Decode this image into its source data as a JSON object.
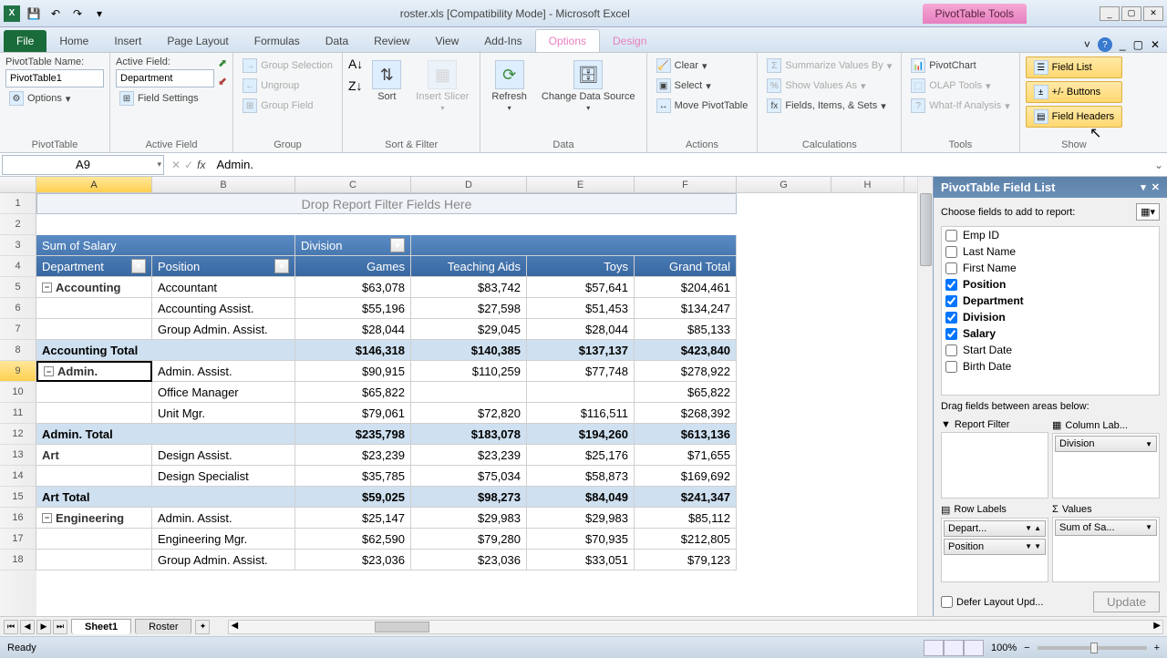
{
  "title": "roster.xls  [Compatibility Mode] - Microsoft Excel",
  "context_tab": "PivotTable Tools",
  "tabs": [
    "File",
    "Home",
    "Insert",
    "Page Layout",
    "Formulas",
    "Data",
    "Review",
    "View",
    "Add-Ins",
    "Options",
    "Design"
  ],
  "active_tab": "Options",
  "ribbon": {
    "pt_name_label": "PivotTable Name:",
    "pt_name": "PivotTable1",
    "options": "Options",
    "group_pt": "PivotTable",
    "af_label": "Active Field:",
    "af_name": "Department",
    "field_settings": "Field Settings",
    "group_af": "Active Field",
    "grp_sel": "Group Selection",
    "ungroup": "Ungroup",
    "grp_field": "Group Field",
    "group_grp": "Group",
    "sort": "Sort",
    "insert_slicer": "Insert Slicer",
    "group_sort": "Sort & Filter",
    "refresh": "Refresh",
    "change_ds": "Change Data Source",
    "group_data": "Data",
    "clear": "Clear",
    "select": "Select",
    "move_pt": "Move PivotTable",
    "group_actions": "Actions",
    "sum_values": "Summarize Values By",
    "show_values": "Show Values As",
    "fields_items": "Fields, Items, & Sets",
    "group_calc": "Calculations",
    "pivotchart": "PivotChart",
    "olap": "OLAP Tools",
    "whatif": "What-If Analysis",
    "group_tools": "Tools",
    "field_list": "Field List",
    "pm_buttons": "+/- Buttons",
    "field_headers": "Field Headers",
    "group_show": "Show"
  },
  "namebox": "A9",
  "formula": "Admin.",
  "columns": [
    "A",
    "B",
    "C",
    "D",
    "E",
    "F",
    "G",
    "H"
  ],
  "drop_text": "Drop Report Filter Fields Here",
  "headers": {
    "sum_salary": "Sum of Salary",
    "division": "Division",
    "department": "Department",
    "position": "Position",
    "games": "Games",
    "teaching": "Teaching Aids",
    "toys": "Toys",
    "grand_total": "Grand Total"
  },
  "rows": [
    {
      "r": 5,
      "cat": "Accounting",
      "pos": "Accountant",
      "c": "$63,078",
      "d": "$83,742",
      "e": "$57,641",
      "f": "$204,461"
    },
    {
      "r": 6,
      "pos": "Accounting Assist.",
      "c": "$55,196",
      "d": "$27,598",
      "e": "$51,453",
      "f": "$134,247"
    },
    {
      "r": 7,
      "pos": "Group Admin. Assist.",
      "c": "$28,044",
      "d": "$29,045",
      "e": "$28,044",
      "f": "$85,133"
    },
    {
      "r": 8,
      "total": "Accounting Total",
      "c": "$146,318",
      "d": "$140,385",
      "e": "$137,137",
      "f": "$423,840"
    },
    {
      "r": 9,
      "cat": "Admin.",
      "pos": "Admin. Assist.",
      "c": "$90,915",
      "d": "$110,259",
      "e": "$77,748",
      "f": "$278,922",
      "sel": true
    },
    {
      "r": 10,
      "pos": "Office Manager",
      "c": "$65,822",
      "d": "",
      "e": "",
      "f": "$65,822"
    },
    {
      "r": 11,
      "pos": "Unit Mgr.",
      "c": "$79,061",
      "d": "$72,820",
      "e": "$116,511",
      "f": "$268,392"
    },
    {
      "r": 12,
      "total": "Admin. Total",
      "c": "$235,798",
      "d": "$183,078",
      "e": "$194,260",
      "f": "$613,136"
    },
    {
      "r": 13,
      "cat": "Art",
      "pos": "Design Assist.",
      "c": "$23,239",
      "d": "$23,239",
      "e": "$25,176",
      "f": "$71,655",
      "no_collapse": true
    },
    {
      "r": 14,
      "pos": "Design Specialist",
      "c": "$35,785",
      "d": "$75,034",
      "e": "$58,873",
      "f": "$169,692"
    },
    {
      "r": 15,
      "total": "Art Total",
      "c": "$59,025",
      "d": "$98,273",
      "e": "$84,049",
      "f": "$241,347"
    },
    {
      "r": 16,
      "cat": "Engineering",
      "pos": "Admin. Assist.",
      "c": "$25,147",
      "d": "$29,983",
      "e": "$29,983",
      "f": "$85,112"
    },
    {
      "r": 17,
      "pos": "Engineering Mgr.",
      "c": "$62,590",
      "d": "$79,280",
      "e": "$70,935",
      "f": "$212,805"
    },
    {
      "r": 18,
      "pos": "Group Admin. Assist.",
      "c": "$23,036",
      "d": "$23,036",
      "e": "$33,051",
      "f": "$79,123"
    }
  ],
  "fieldlist": {
    "title": "PivotTable Field List",
    "choose": "Choose fields to add to report:",
    "fields": [
      {
        "name": "Emp ID",
        "checked": false
      },
      {
        "name": "Last Name",
        "checked": false
      },
      {
        "name": "First Name",
        "checked": false
      },
      {
        "name": "Position",
        "checked": true
      },
      {
        "name": "Department",
        "checked": true
      },
      {
        "name": "Division",
        "checked": true
      },
      {
        "name": "Salary",
        "checked": true
      },
      {
        "name": "Start Date",
        "checked": false
      },
      {
        "name": "Birth Date",
        "checked": false
      }
    ],
    "drag": "Drag fields between areas below:",
    "report_filter": "Report Filter",
    "col_labels": "Column Lab...",
    "row_labels": "Row Labels",
    "values": "Values",
    "chip_division": "Division",
    "chip_depart": "Depart...",
    "chip_position": "Position",
    "chip_sum": "Sum of Sa...",
    "defer": "Defer Layout Upd...",
    "update": "Update"
  },
  "sheets": [
    "Sheet1",
    "Roster"
  ],
  "status": "Ready",
  "zoom": "100%"
}
